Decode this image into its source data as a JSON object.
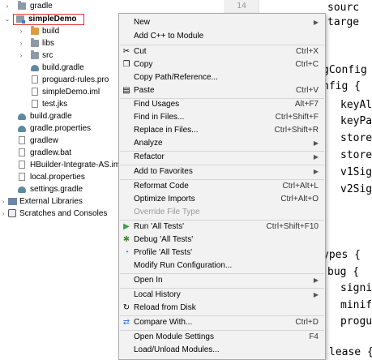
{
  "project_tree": {
    "items": [
      {
        "label": "gradle",
        "icon": "folder-icon",
        "arrow": "›",
        "bold": false
      },
      {
        "label": "simpleDemo",
        "icon": "module-folder-icon",
        "arrow": "⌄",
        "bold": true
      },
      {
        "label": "build",
        "icon": "folder-orange-icon",
        "arrow": "›",
        "bold": false
      },
      {
        "label": "libs",
        "icon": "folder-icon",
        "arrow": "›",
        "bold": false
      },
      {
        "label": "src",
        "icon": "folder-icon",
        "arrow": "›",
        "bold": false
      },
      {
        "label": "build.gradle",
        "icon": "gradle-icon",
        "arrow": "",
        "bold": false
      },
      {
        "label": "proguard-rules.pro",
        "icon": "file-icon",
        "arrow": "",
        "bold": false
      },
      {
        "label": "simpleDemo.iml",
        "icon": "file-icon",
        "arrow": "",
        "bold": false
      },
      {
        "label": "test.jks",
        "icon": "file-icon",
        "arrow": "",
        "bold": false
      },
      {
        "label": "build.gradle",
        "icon": "gradle-icon",
        "arrow": "",
        "bold": false
      },
      {
        "label": "gradle.properties",
        "icon": "gradle-icon",
        "arrow": "",
        "bold": false
      },
      {
        "label": "gradlew",
        "icon": "file-icon",
        "arrow": "",
        "bold": false
      },
      {
        "label": "gradlew.bat",
        "icon": "file-icon",
        "arrow": "",
        "bold": false
      },
      {
        "label": "HBuilder-Integrate-AS.im",
        "icon": "file-icon",
        "arrow": "",
        "bold": false
      },
      {
        "label": "local.properties",
        "icon": "file-icon",
        "arrow": "",
        "bold": false
      },
      {
        "label": "settings.gradle",
        "icon": "gradle-icon",
        "arrow": "",
        "bold": false
      },
      {
        "label": "External Libraries",
        "icon": "libraries-icon",
        "arrow": "›",
        "bold": false
      },
      {
        "label": "Scratches and Consoles",
        "icon": "scratches-icon",
        "arrow": "›",
        "bold": false
      }
    ]
  },
  "editor": {
    "line_number": "14",
    "code_lines": [
      "sourc",
      "targe",
      "gConfig",
      "nfig {",
      "keyAl",
      "keyPa",
      "store",
      "store",
      "v1Sig",
      "v2Sig",
      "ypes {",
      "bug {",
      "signi",
      "minif",
      "progu",
      "lease {"
    ]
  },
  "context_menu": {
    "items": [
      {
        "label": "New",
        "shortcut": "",
        "submenu": true,
        "icon": "",
        "disabled": false
      },
      {
        "label": "Add C++ to Module",
        "shortcut": "",
        "submenu": false,
        "icon": "",
        "disabled": false
      },
      {
        "label": "Cut",
        "shortcut": "Ctrl+X",
        "submenu": false,
        "icon": "scissors-icon",
        "disabled": false
      },
      {
        "label": "Copy",
        "shortcut": "Ctrl+C",
        "submenu": false,
        "icon": "copy-icon",
        "disabled": false
      },
      {
        "label": "Copy Path/Reference...",
        "shortcut": "",
        "submenu": false,
        "icon": "",
        "disabled": false
      },
      {
        "label": "Paste",
        "shortcut": "Ctrl+V",
        "submenu": false,
        "icon": "paste-icon",
        "disabled": false
      },
      {
        "label": "Find Usages",
        "shortcut": "Alt+F7",
        "submenu": false,
        "icon": "",
        "disabled": false
      },
      {
        "label": "Find in Files...",
        "shortcut": "Ctrl+Shift+F",
        "submenu": false,
        "icon": "",
        "disabled": false
      },
      {
        "label": "Replace in Files...",
        "shortcut": "Ctrl+Shift+R",
        "submenu": false,
        "icon": "",
        "disabled": false
      },
      {
        "label": "Analyze",
        "shortcut": "",
        "submenu": true,
        "icon": "",
        "disabled": false
      },
      {
        "label": "Refactor",
        "shortcut": "",
        "submenu": true,
        "icon": "",
        "disabled": false
      },
      {
        "label": "Add to Favorites",
        "shortcut": "",
        "submenu": true,
        "icon": "",
        "disabled": false
      },
      {
        "label": "Reformat Code",
        "shortcut": "Ctrl+Alt+L",
        "submenu": false,
        "icon": "",
        "disabled": false
      },
      {
        "label": "Optimize Imports",
        "shortcut": "Ctrl+Alt+O",
        "submenu": false,
        "icon": "",
        "disabled": false
      },
      {
        "label": "Override File Type",
        "shortcut": "",
        "submenu": false,
        "icon": "",
        "disabled": true
      },
      {
        "label": "Run 'All Tests'",
        "shortcut": "Ctrl+Shift+F10",
        "submenu": false,
        "icon": "run-icon",
        "disabled": false
      },
      {
        "label": "Debug 'All Tests'",
        "shortcut": "",
        "submenu": false,
        "icon": "debug-icon",
        "disabled": false
      },
      {
        "label": "Profile 'All Tests'",
        "shortcut": "",
        "submenu": false,
        "icon": "profile-icon",
        "disabled": false
      },
      {
        "label": "Modify Run Configuration...",
        "shortcut": "",
        "submenu": false,
        "icon": "",
        "disabled": false
      },
      {
        "label": "Open In",
        "shortcut": "",
        "submenu": true,
        "icon": "",
        "disabled": false
      },
      {
        "label": "Local History",
        "shortcut": "",
        "submenu": true,
        "icon": "",
        "disabled": false
      },
      {
        "label": "Reload from Disk",
        "shortcut": "",
        "submenu": false,
        "icon": "reload-icon",
        "disabled": false
      },
      {
        "label": "Compare With...",
        "shortcut": "Ctrl+D",
        "submenu": false,
        "icon": "compare-icon",
        "disabled": false
      },
      {
        "label": "Open Module Settings",
        "shortcut": "F4",
        "submenu": false,
        "icon": "",
        "disabled": false
      },
      {
        "label": "Load/Unload Modules...",
        "shortcut": "",
        "submenu": false,
        "icon": "",
        "disabled": false
      }
    ]
  },
  "colors": {
    "selection_outline": "#e0322e",
    "run_icon": "#3f9b4a",
    "debug_icon": "#4a8a3a",
    "menu_background": "#f2f2f2"
  }
}
